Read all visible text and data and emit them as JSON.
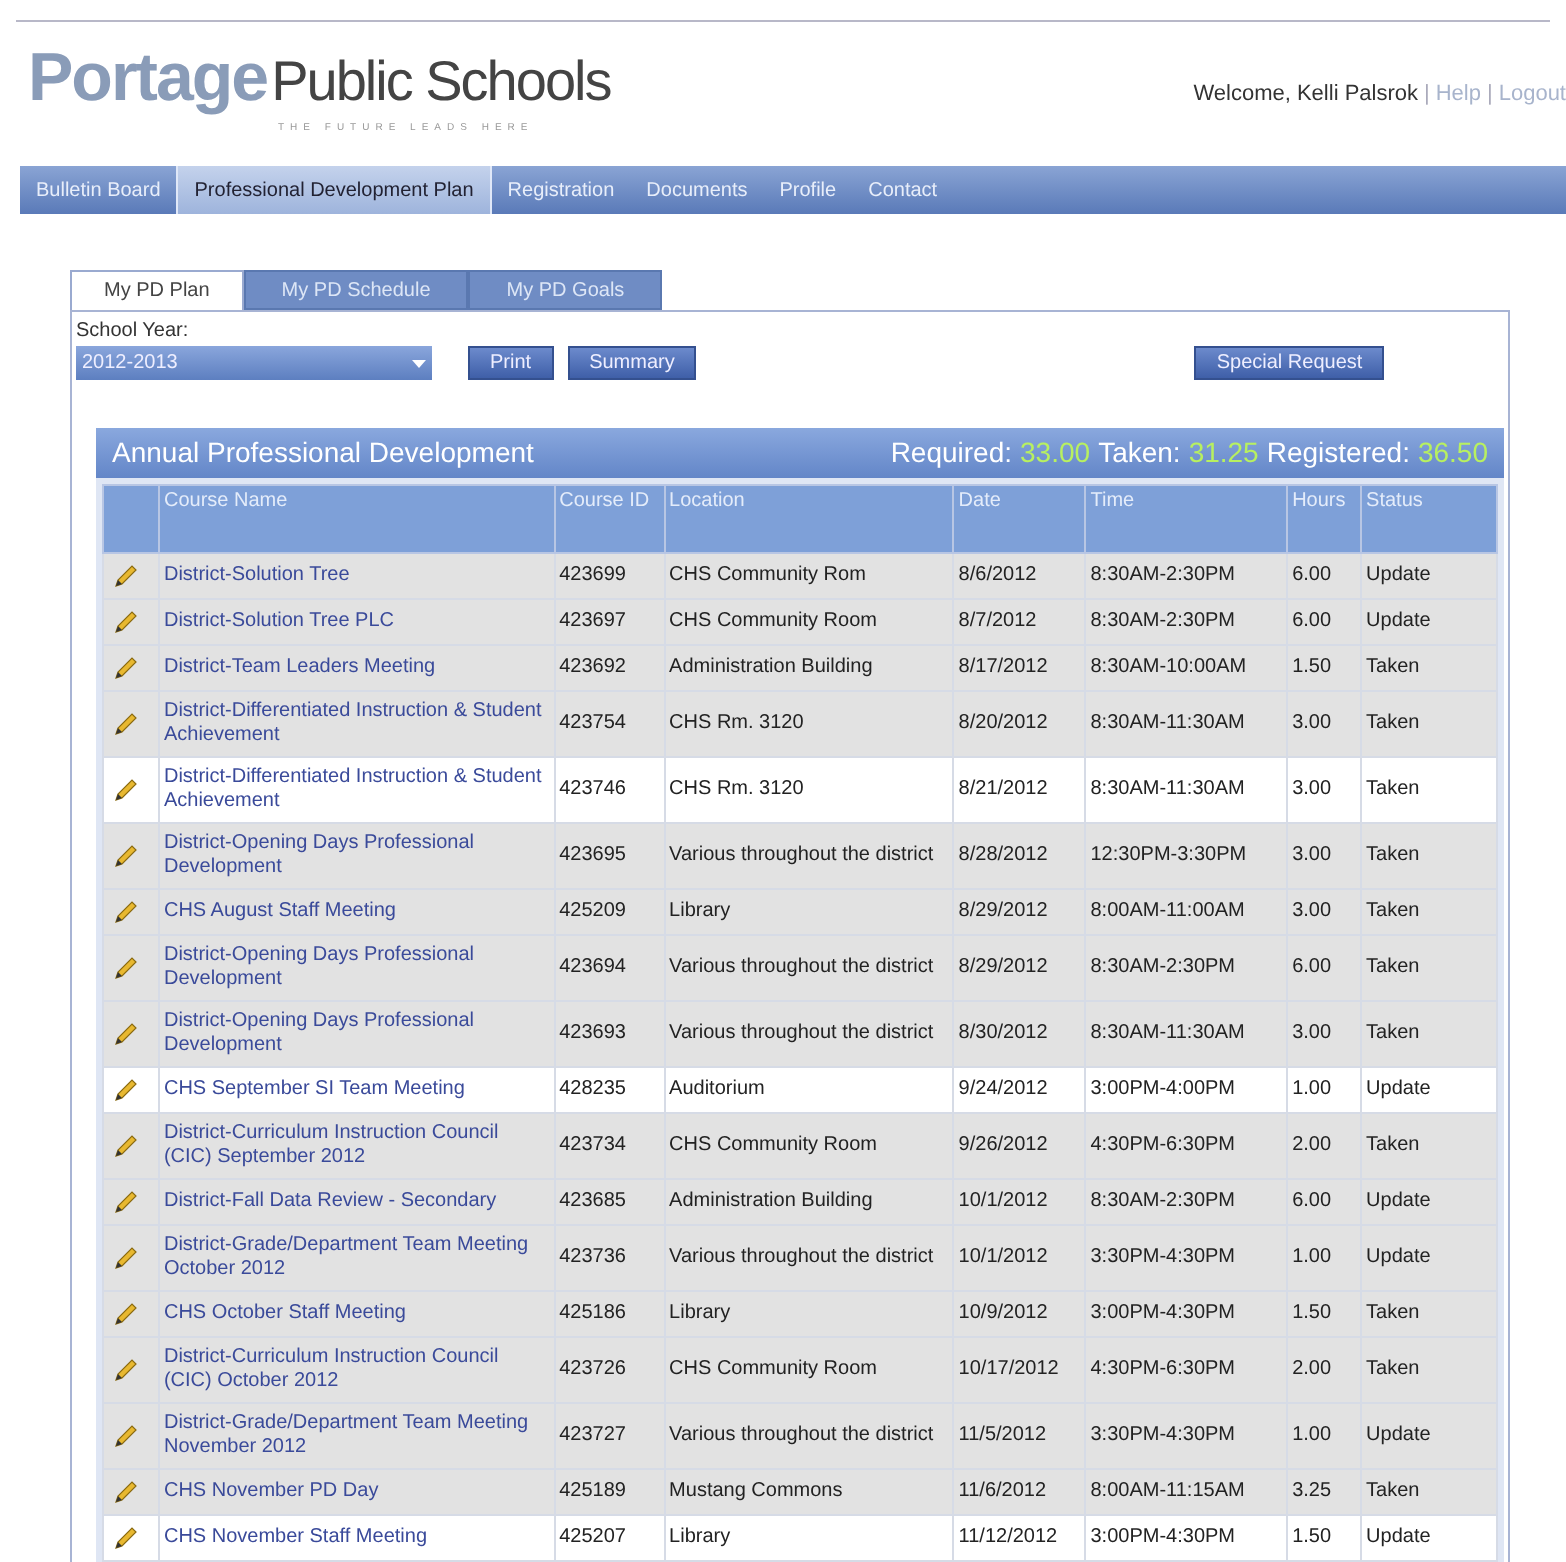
{
  "logo": {
    "brand": "Portage",
    "name": "Public Schools",
    "tagline": "THE FUTURE LEADS HERE"
  },
  "user_bar": {
    "welcome": "Welcome, Kelli Palsrok",
    "links": [
      {
        "separator": "|",
        "label": "Help"
      },
      {
        "separator": "|",
        "label": "Logout"
      }
    ]
  },
  "nav": [
    {
      "label": "Bulletin Board",
      "selected": false
    },
    {
      "label": "Professional Development Plan",
      "selected": true
    },
    {
      "label": "Registration",
      "selected": false
    },
    {
      "label": "Documents",
      "selected": false
    },
    {
      "label": "Profile",
      "selected": false
    },
    {
      "label": "Contact",
      "selected": false
    }
  ],
  "tabs": [
    {
      "label": "My PD Plan",
      "selected": true
    },
    {
      "label": "My PD Schedule",
      "selected": false
    },
    {
      "label": "My PD Goals",
      "selected": false
    }
  ],
  "school_year": {
    "label": "School Year:",
    "value": "2012-2013"
  },
  "buttons": [
    "Print",
    "Summary"
  ],
  "special_request": "Special Request",
  "panel": {
    "title": "Annual Professional Development",
    "totals": [
      {
        "label": "Required:",
        "value": "33.00"
      },
      {
        "label": "Taken:",
        "value": "31.25"
      },
      {
        "label": "Registered:",
        "value": "36.50"
      }
    ]
  },
  "table": {
    "columns": [
      "Course Name",
      "Course ID",
      "Location",
      "Date",
      "Time",
      "Hours",
      "Status"
    ],
    "rows": [
      {
        "name": "District-Solution Tree",
        "id": "423699",
        "location": "CHS Community Rom",
        "date": "8/6/2012",
        "time": "8:30AM-2:30PM",
        "hours": "6.00",
        "status": "Update",
        "highlighted": false
      },
      {
        "name": "District-Solution Tree PLC",
        "id": "423697",
        "location": "CHS Community Room",
        "date": "8/7/2012",
        "time": "8:30AM-2:30PM",
        "hours": "6.00",
        "status": "Update",
        "highlighted": false
      },
      {
        "name": "District-Team Leaders Meeting",
        "id": "423692",
        "location": "Administration Building",
        "date": "8/17/2012",
        "time": "8:30AM-10:00AM",
        "hours": "1.50",
        "status": "Taken",
        "highlighted": false
      },
      {
        "name": "District-Differentiated Instruction & Student Achievement",
        "id": "423754",
        "location": "CHS Rm. 3120",
        "date": "8/20/2012",
        "time": "8:30AM-11:30AM",
        "hours": "3.00",
        "status": "Taken",
        "highlighted": false
      },
      {
        "name": "District-Differentiated Instruction & Student Achievement",
        "id": "423746",
        "location": "CHS Rm. 3120",
        "date": "8/21/2012",
        "time": "8:30AM-11:30AM",
        "hours": "3.00",
        "status": "Taken",
        "highlighted": true
      },
      {
        "name": "District-Opening Days Professional Development",
        "id": "423695",
        "location": "Various throughout the district",
        "date": "8/28/2012",
        "time": "12:30PM-3:30PM",
        "hours": "3.00",
        "status": "Taken",
        "highlighted": false
      },
      {
        "name": "CHS August Staff Meeting",
        "id": "425209",
        "location": "Library",
        "date": "8/29/2012",
        "time": "8:00AM-11:00AM",
        "hours": "3.00",
        "status": "Taken",
        "highlighted": false
      },
      {
        "name": "District-Opening Days Professional Development",
        "id": "423694",
        "location": "Various throughout the district",
        "date": "8/29/2012",
        "time": "8:30AM-2:30PM",
        "hours": "6.00",
        "status": "Taken",
        "highlighted": false
      },
      {
        "name": "District-Opening Days Professional Development",
        "id": "423693",
        "location": "Various throughout the district",
        "date": "8/30/2012",
        "time": "8:30AM-11:30AM",
        "hours": "3.00",
        "status": "Taken",
        "highlighted": false
      },
      {
        "name": "CHS September SI Team Meeting",
        "id": "428235",
        "location": "Auditorium",
        "date": "9/24/2012",
        "time": "3:00PM-4:00PM",
        "hours": "1.00",
        "status": "Update",
        "highlighted": true
      },
      {
        "name": "District-Curriculum Instruction Council (CIC) September 2012",
        "id": "423734",
        "location": "CHS Community Room",
        "date": "9/26/2012",
        "time": "4:30PM-6:30PM",
        "hours": "2.00",
        "status": "Taken",
        "highlighted": false
      },
      {
        "name": "District-Fall Data Review - Secondary",
        "id": "423685",
        "location": "Administration Building",
        "date": "10/1/2012",
        "time": "8:30AM-2:30PM",
        "hours": "6.00",
        "status": "Update",
        "highlighted": false
      },
      {
        "name": "District-Grade/Department Team Meeting October 2012",
        "id": "423736",
        "location": "Various throughout the district",
        "date": "10/1/2012",
        "time": "3:30PM-4:30PM",
        "hours": "1.00",
        "status": "Update",
        "highlighted": false
      },
      {
        "name": "CHS October Staff Meeting",
        "id": "425186",
        "location": "Library",
        "date": "10/9/2012",
        "time": "3:00PM-4:30PM",
        "hours": "1.50",
        "status": "Taken",
        "highlighted": false
      },
      {
        "name": "District-Curriculum Instruction Council (CIC) October 2012",
        "id": "423726",
        "location": "CHS Community Room",
        "date": "10/17/2012",
        "time": "4:30PM-6:30PM",
        "hours": "2.00",
        "status": "Taken",
        "highlighted": false
      },
      {
        "name": "District-Grade/Department Team Meeting November 2012",
        "id": "423727",
        "location": "Various throughout the district",
        "date": "11/5/2012",
        "time": "3:30PM-4:30PM",
        "hours": "1.00",
        "status": "Update",
        "highlighted": false
      },
      {
        "name": "CHS November PD Day",
        "id": "425189",
        "location": "Mustang Commons",
        "date": "11/6/2012",
        "time": "8:00AM-11:15AM",
        "hours": "3.25",
        "status": "Taken",
        "highlighted": false
      },
      {
        "name": "CHS November Staff Meeting",
        "id": "425207",
        "location": "Library",
        "date": "11/12/2012",
        "time": "3:00PM-4:30PM",
        "hours": "1.50",
        "status": "Update",
        "highlighted": true
      }
    ]
  }
}
